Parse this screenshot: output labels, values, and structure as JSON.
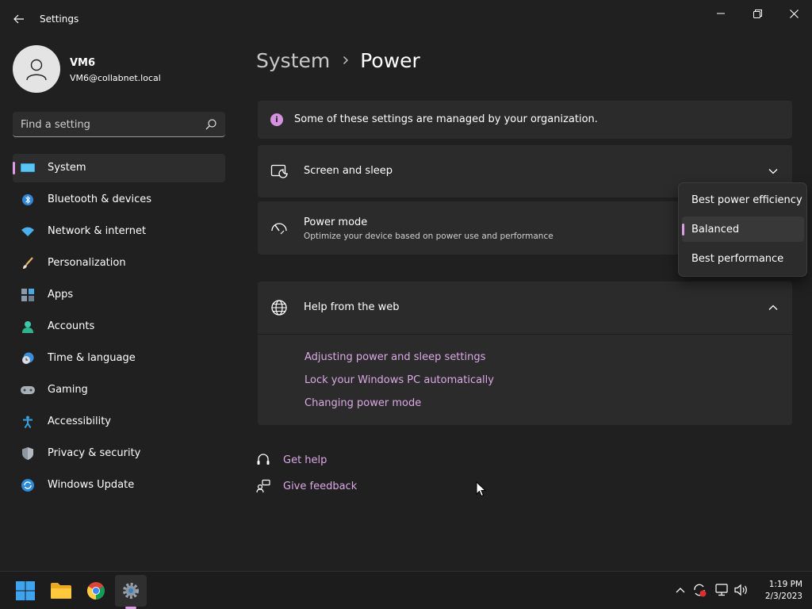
{
  "window": {
    "app_title": "Settings"
  },
  "profile": {
    "name": "VM6",
    "email": "VM6@collabnet.local"
  },
  "search": {
    "placeholder": "Find a setting"
  },
  "sidebar": {
    "items": [
      {
        "label": "System",
        "icon": "system-icon",
        "selected": true
      },
      {
        "label": "Bluetooth & devices",
        "icon": "bluetooth-icon"
      },
      {
        "label": "Network & internet",
        "icon": "wifi-icon"
      },
      {
        "label": "Personalization",
        "icon": "brush-icon"
      },
      {
        "label": "Apps",
        "icon": "apps-icon"
      },
      {
        "label": "Accounts",
        "icon": "accounts-icon"
      },
      {
        "label": "Time & language",
        "icon": "clock-globe-icon"
      },
      {
        "label": "Gaming",
        "icon": "gamepad-icon"
      },
      {
        "label": "Accessibility",
        "icon": "accessibility-icon"
      },
      {
        "label": "Privacy & security",
        "icon": "shield-icon"
      },
      {
        "label": "Windows Update",
        "icon": "update-icon"
      }
    ]
  },
  "breadcrumb": {
    "parent": "System",
    "current": "Power"
  },
  "notice": {
    "text": "Some of these settings are managed by your organization."
  },
  "screen_sleep": {
    "title": "Screen and sleep"
  },
  "power_mode": {
    "title": "Power mode",
    "subtitle": "Optimize your device based on power use and performance",
    "options": [
      "Best power efficiency",
      "Balanced",
      "Best performance"
    ],
    "selected": "Balanced"
  },
  "help": {
    "title": "Help from the web",
    "links": [
      "Adjusting power and sleep settings",
      "Lock your Windows PC automatically",
      "Changing power mode"
    ]
  },
  "footer": {
    "get_help": "Get help",
    "give_feedback": "Give feedback"
  },
  "taskbar": {
    "time": "1:19 PM",
    "date": "2/3/2023"
  },
  "colors": {
    "background": "#202020",
    "card": "#2b2b2b",
    "accent": "#dd9ee6",
    "link": "#dca9e6"
  }
}
